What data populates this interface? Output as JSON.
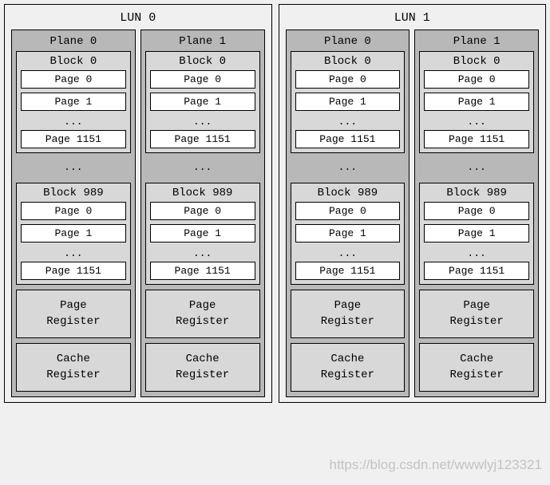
{
  "luns": [
    {
      "title": "LUN 0",
      "planes": [
        {
          "title": "Plane 0",
          "block_first": {
            "title": "Block 0",
            "page0": "Page 0",
            "page1": "Page 1",
            "ellipsis": "...",
            "pageN": "Page 1151"
          },
          "block_ellipsis": "...",
          "block_last": {
            "title": "Block 989",
            "page0": "Page 0",
            "page1": "Page 1",
            "ellipsis": "...",
            "pageN": "Page 1151"
          },
          "page_register": "Page\nRegister",
          "cache_register": "Cache\nRegister"
        },
        {
          "title": "Plane 1",
          "block_first": {
            "title": "Block 0",
            "page0": "Page 0",
            "page1": "Page 1",
            "ellipsis": "...",
            "pageN": "Page 1151"
          },
          "block_ellipsis": "...",
          "block_last": {
            "title": "Block 989",
            "page0": "Page 0",
            "page1": "Page 1",
            "ellipsis": "...",
            "pageN": "Page 1151"
          },
          "page_register": "Page\nRegister",
          "cache_register": "Cache\nRegister"
        }
      ]
    },
    {
      "title": "LUN 1",
      "planes": [
        {
          "title": "Plane 0",
          "block_first": {
            "title": "Block 0",
            "page0": "Page 0",
            "page1": "Page 1",
            "ellipsis": "...",
            "pageN": "Page 1151"
          },
          "block_ellipsis": "...",
          "block_last": {
            "title": "Block 989",
            "page0": "Page 0",
            "page1": "Page 1",
            "ellipsis": "...",
            "pageN": "Page 1151"
          },
          "page_register": "Page\nRegister",
          "cache_register": "Cache\nRegister"
        },
        {
          "title": "Plane 1",
          "block_first": {
            "title": "Block 0",
            "page0": "Page 0",
            "page1": "Page 1",
            "ellipsis": "...",
            "pageN": "Page 1151"
          },
          "block_ellipsis": "...",
          "block_last": {
            "title": "Block 989",
            "page0": "Page 0",
            "page1": "Page 1",
            "ellipsis": "...",
            "pageN": "Page 1151"
          },
          "page_register": "Page\nRegister",
          "cache_register": "Cache\nRegister"
        }
      ]
    }
  ],
  "watermark": "https://blog.csdn.net/wwwlyj123321"
}
